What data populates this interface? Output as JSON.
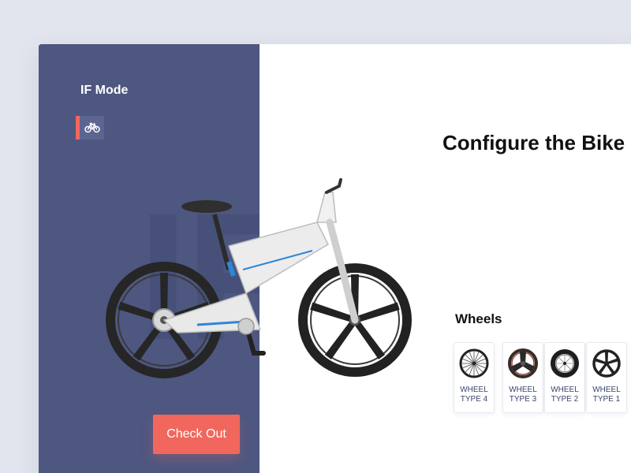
{
  "sidebar": {
    "mode_title": "IF Mode",
    "watermark": "IF",
    "checkout_label": "Check Out",
    "mode_icon": "bicycle-icon",
    "accent_color": "#f2675d",
    "bg_color": "#4e5780"
  },
  "main": {
    "title": "Configure the Bike",
    "wheels_section": {
      "title": "Wheels",
      "options": [
        {
          "label": "WHEEL TYPE 4",
          "icon": "wire-spoke-wheel-icon"
        },
        {
          "label": "WHEEL TYPE 3",
          "icon": "tri-spoke-wheel-icon"
        },
        {
          "label": "WHEEL TYPE 2",
          "icon": "deep-rim-wheel-icon"
        },
        {
          "label": "WHEEL TYPE 1",
          "icon": "five-spoke-wheel-icon"
        }
      ]
    }
  }
}
